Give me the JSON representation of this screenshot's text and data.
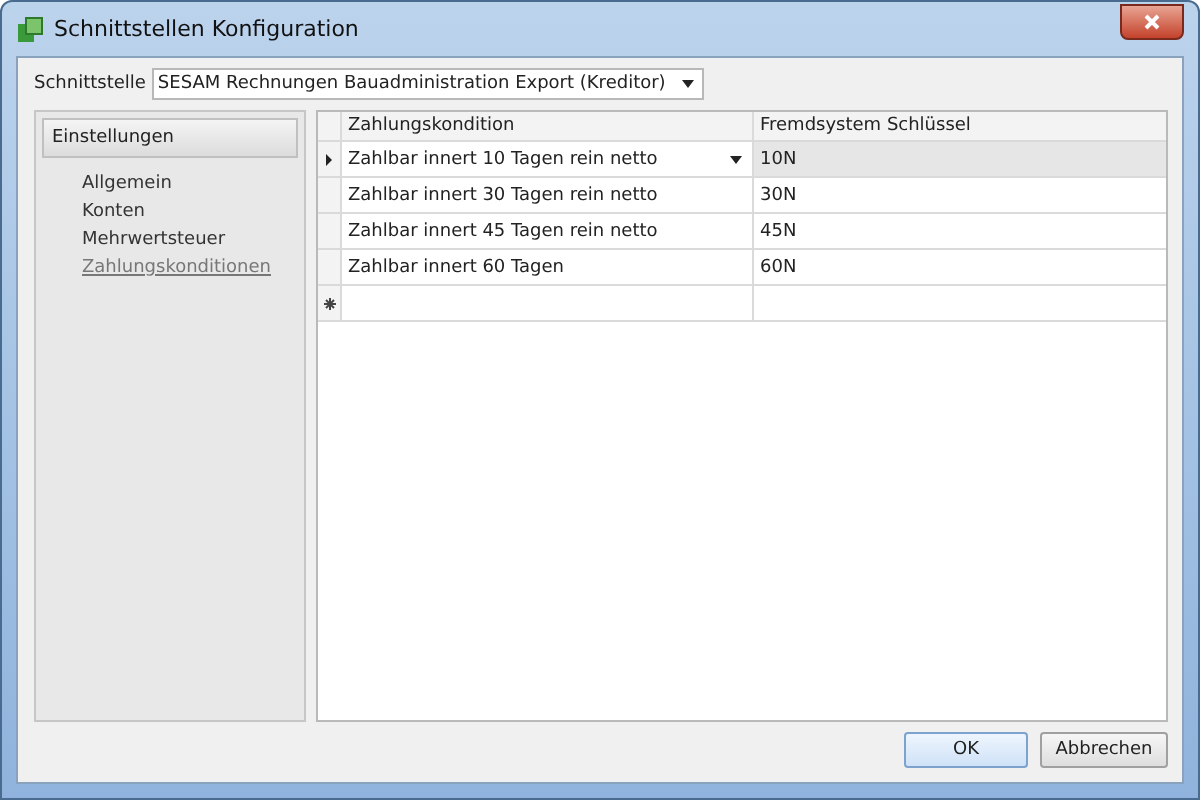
{
  "window": {
    "title": "Schnittstellen Konfiguration"
  },
  "interface_select": {
    "label": "Schnittstelle",
    "value": "SESAM Rechnungen Bauadministration Export (Kreditor)"
  },
  "sidebar": {
    "group": "Einstellungen",
    "items": [
      {
        "label": "Allgemein",
        "selected": false
      },
      {
        "label": "Konten",
        "selected": false
      },
      {
        "label": "Mehrwertsteuer",
        "selected": false
      },
      {
        "label": "Zahlungskonditionen",
        "selected": true
      }
    ]
  },
  "table": {
    "columns": [
      "Zahlungskondition",
      "Fremdsystem Schlüssel"
    ],
    "rows": [
      {
        "cells": [
          "Zahlbar innert 10 Tagen rein netto",
          "10N"
        ],
        "selected": true
      },
      {
        "cells": [
          "Zahlbar innert 30 Tagen rein netto",
          "30N"
        ],
        "selected": false
      },
      {
        "cells": [
          "Zahlbar innert 45 Tagen rein netto",
          "45N"
        ],
        "selected": false
      },
      {
        "cells": [
          "Zahlbar innert 60 Tagen",
          "60N"
        ],
        "selected": false
      }
    ]
  },
  "buttons": [
    {
      "label": "OK",
      "default": true
    },
    {
      "label": "Abbrechen",
      "default": false
    }
  ]
}
